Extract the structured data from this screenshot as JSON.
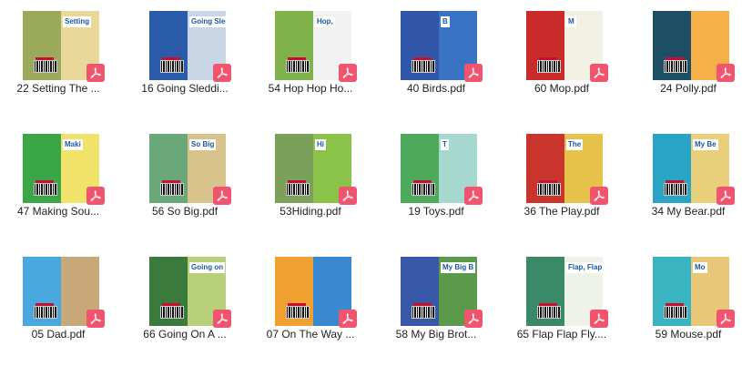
{
  "files": [
    {
      "label": "22 Setting The ...",
      "back": "#9aa95a",
      "front": "#e8d89a",
      "cover_title": "Setting"
    },
    {
      "label": "16 Going Sleddi...",
      "back": "#2a5caa",
      "front": "#c9d6e6",
      "cover_title": "Going Sled"
    },
    {
      "label": "54 Hop Hop Ho...",
      "back": "#7fb24b",
      "front": "#f2f2f2",
      "cover_title": "Hop,"
    },
    {
      "label": "40 Birds.pdf",
      "back": "#3257a8",
      "front": "#3a72c4",
      "cover_title": "B"
    },
    {
      "label": "60 Mop.pdf",
      "back": "#c92a2a",
      "front": "#f3f0e4",
      "cover_title": "M"
    },
    {
      "label": "24 Polly.pdf",
      "back": "#1d4e63",
      "front": "#f5b04a",
      "cover_title": ""
    },
    {
      "label": "47 Making Sou...",
      "back": "#3aa646",
      "front": "#f1e36a",
      "cover_title": "Maki"
    },
    {
      "label": "56 So Big.pdf",
      "back": "#6aa87a",
      "front": "#d9c38c",
      "cover_title": "So Big"
    },
    {
      "label": "53Hiding.pdf",
      "back": "#7aa05a",
      "front": "#8bc34a",
      "cover_title": "Hi"
    },
    {
      "label": "19 Toys.pdf",
      "back": "#4daa5a",
      "front": "#a7d8d0",
      "cover_title": "T"
    },
    {
      "label": "36 The Play.pdf",
      "back": "#c9342c",
      "front": "#e6c24a",
      "cover_title": "The"
    },
    {
      "label": "34 My Bear.pdf",
      "back": "#2aa4c4",
      "front": "#e8d07a",
      "cover_title": "My Be"
    },
    {
      "label": "05 Dad.pdf",
      "back": "#4aa8e0",
      "front": "#c8a878",
      "cover_title": ""
    },
    {
      "label": "66 Going On A ...",
      "back": "#3a7a3a",
      "front": "#b8d07a",
      "cover_title": "Going on"
    },
    {
      "label": "07 On The Way ...",
      "back": "#f0a030",
      "front": "#3a88d0",
      "cover_title": ""
    },
    {
      "label": "58 My Big Brot...",
      "back": "#3a58a8",
      "front": "#5a9a4a",
      "cover_title": "My Big B"
    },
    {
      "label": "65 Flap Flap Fly....",
      "back": "#3a8a6a",
      "front": "#eef2e8",
      "cover_title": "Flap, Flap"
    },
    {
      "label": "59 Mouse.pdf",
      "back": "#3ab4c0",
      "front": "#e8c878",
      "cover_title": "Mo"
    }
  ],
  "icons": {
    "badge": "pdf-icon",
    "badge_color": "#f0546e"
  }
}
